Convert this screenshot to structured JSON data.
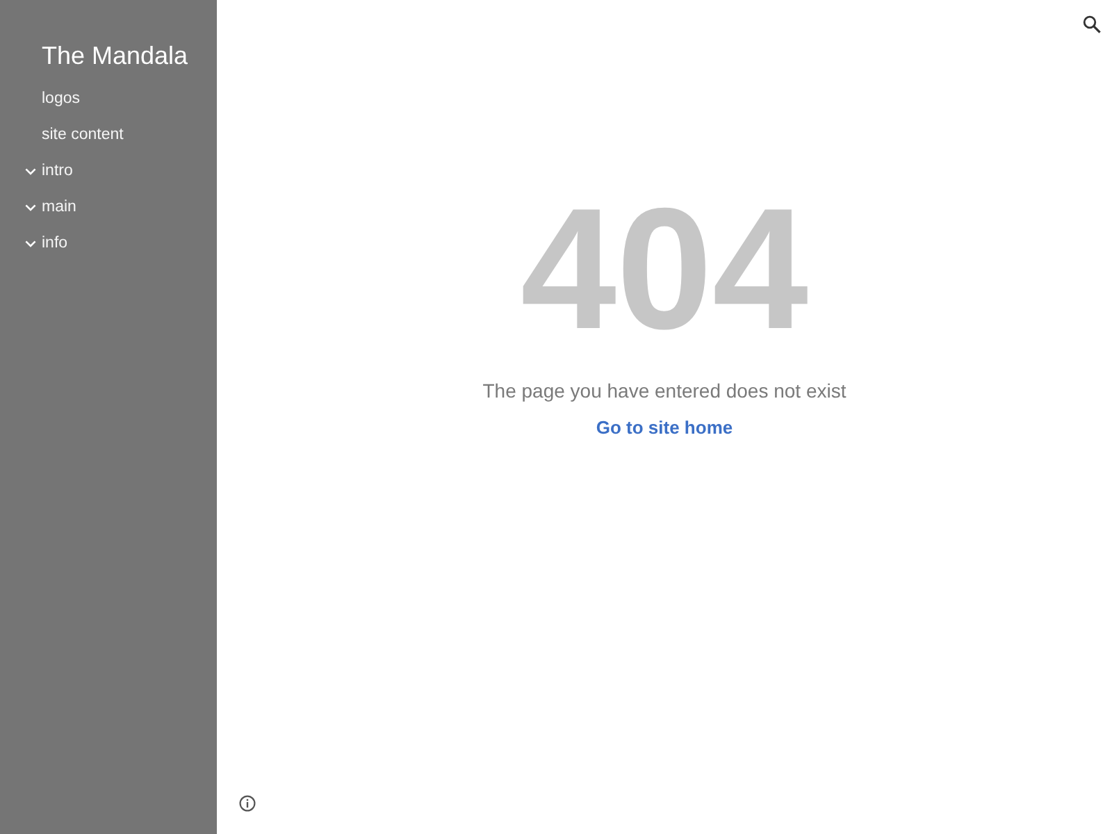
{
  "sidebar": {
    "site_title": "The Mandala",
    "items": [
      {
        "label": "logos",
        "kind": "page"
      },
      {
        "label": "site content",
        "kind": "page"
      },
      {
        "label": "intro",
        "kind": "section",
        "expanded": false
      },
      {
        "label": "main",
        "kind": "section",
        "expanded": false
      },
      {
        "label": "info",
        "kind": "section",
        "expanded": false
      }
    ]
  },
  "error": {
    "code": "404",
    "message": "The page you have entered does not exist",
    "link": "Go to site home"
  }
}
